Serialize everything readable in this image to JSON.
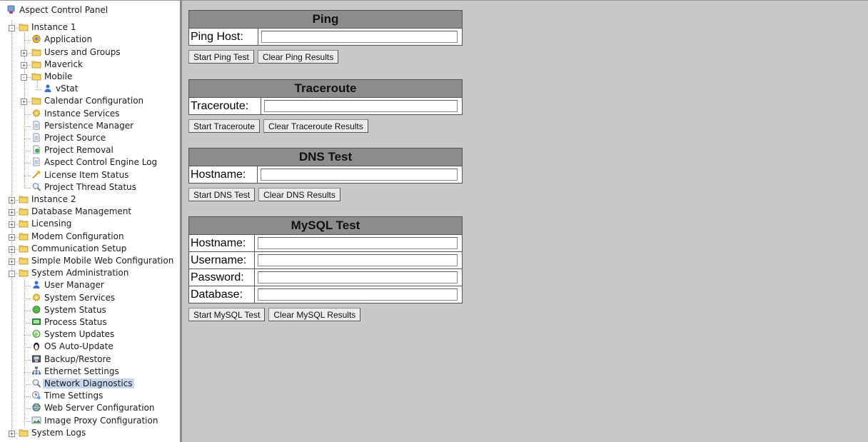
{
  "tree": [
    {
      "label": "Aspect Control Panel",
      "icon": "control-panel-icon",
      "level": 0,
      "toggle": ""
    },
    {
      "label": "Instance 1",
      "icon": "folder-icon",
      "level": 1,
      "toggle": "-"
    },
    {
      "label": "Application",
      "icon": "application-icon",
      "level": 2,
      "toggle": ""
    },
    {
      "label": "Users and Groups",
      "icon": "folder-icon",
      "level": 2,
      "toggle": "+"
    },
    {
      "label": "Maverick",
      "icon": "folder-icon",
      "level": 2,
      "toggle": "+"
    },
    {
      "label": "Mobile",
      "icon": "folder-icon",
      "level": 2,
      "toggle": "-"
    },
    {
      "label": "vStat",
      "icon": "user-icon",
      "level": 3,
      "toggle": ""
    },
    {
      "label": "Calendar Configuration",
      "icon": "folder-icon",
      "level": 2,
      "toggle": "+"
    },
    {
      "label": "Instance Services",
      "icon": "services-icon",
      "level": 2,
      "toggle": ""
    },
    {
      "label": "Persistence Manager",
      "icon": "document-icon",
      "level": 2,
      "toggle": ""
    },
    {
      "label": "Project Source",
      "icon": "document-icon",
      "level": 2,
      "toggle": ""
    },
    {
      "label": "Project Removal",
      "icon": "removal-icon",
      "level": 2,
      "toggle": ""
    },
    {
      "label": "Aspect Control Engine Log",
      "icon": "document-icon",
      "level": 2,
      "toggle": ""
    },
    {
      "label": "License Item Status",
      "icon": "key-icon",
      "level": 2,
      "toggle": ""
    },
    {
      "label": "Project Thread Status",
      "icon": "magnifier-icon",
      "level": 2,
      "toggle": ""
    },
    {
      "label": "Instance 2",
      "icon": "folder-icon",
      "level": 1,
      "toggle": "+"
    },
    {
      "label": "Database Management",
      "icon": "folder-icon",
      "level": 1,
      "toggle": "+"
    },
    {
      "label": "Licensing",
      "icon": "folder-icon",
      "level": 1,
      "toggle": "+"
    },
    {
      "label": "Modem Configuration",
      "icon": "folder-icon",
      "level": 1,
      "toggle": "+"
    },
    {
      "label": "Communication Setup",
      "icon": "folder-icon",
      "level": 1,
      "toggle": "+"
    },
    {
      "label": "Simple Mobile Web Configuration",
      "icon": "folder-icon",
      "level": 1,
      "toggle": "+"
    },
    {
      "label": "System Administration",
      "icon": "folder-icon",
      "level": 1,
      "toggle": "-"
    },
    {
      "label": "User Manager",
      "icon": "user-icon",
      "level": 2,
      "toggle": ""
    },
    {
      "label": "System Services",
      "icon": "services-icon",
      "level": 2,
      "toggle": ""
    },
    {
      "label": "System Status",
      "icon": "status-icon",
      "level": 2,
      "toggle": ""
    },
    {
      "label": "Process Status",
      "icon": "process-icon",
      "level": 2,
      "toggle": ""
    },
    {
      "label": "System Updates",
      "icon": "updates-icon",
      "level": 2,
      "toggle": ""
    },
    {
      "label": "OS Auto-Update",
      "icon": "penguin-icon",
      "level": 2,
      "toggle": ""
    },
    {
      "label": "Backup/Restore",
      "icon": "backup-icon",
      "level": 2,
      "toggle": ""
    },
    {
      "label": "Ethernet Settings",
      "icon": "network-icon",
      "level": 2,
      "toggle": ""
    },
    {
      "label": "Network Diagnostics",
      "icon": "magnifier-icon",
      "level": 2,
      "toggle": "",
      "selected": true
    },
    {
      "label": "Time Settings",
      "icon": "clock-icon",
      "level": 2,
      "toggle": ""
    },
    {
      "label": "Web Server Configuration",
      "icon": "web-server-icon",
      "level": 2,
      "toggle": ""
    },
    {
      "label": "Image Proxy Configuration",
      "icon": "image-icon",
      "level": 2,
      "toggle": ""
    },
    {
      "label": "System Logs",
      "icon": "folder-icon",
      "level": 1,
      "toggle": "+"
    }
  ],
  "ping": {
    "title": "Ping",
    "host_label": "Ping Host:",
    "host_value": "",
    "start": "Start Ping Test",
    "clear": "Clear Ping Results"
  },
  "traceroute": {
    "title": "Traceroute",
    "host_label": "Traceroute:",
    "host_value": "",
    "start": "Start Traceroute",
    "clear": "Clear Traceroute Results"
  },
  "dns": {
    "title": "DNS Test",
    "host_label": "Hostname:",
    "host_value": "",
    "start": "Start DNS Test",
    "clear": "Clear DNS Results"
  },
  "mysql": {
    "title": "MySQL Test",
    "hostname_label": "Hostname:",
    "username_label": "Username:",
    "password_label": "Password:",
    "database_label": "Database:",
    "hostname_value": "",
    "username_value": "",
    "password_value": "",
    "database_value": "",
    "start": "Start MySQL Test",
    "clear": "Clear MySQL Results"
  },
  "colors": {
    "panel_header": "#8c8c8c",
    "background": "#c8c8c8",
    "selected": "#c6d7ef"
  }
}
